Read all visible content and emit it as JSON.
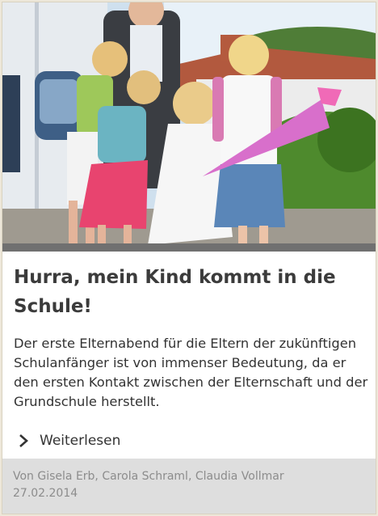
{
  "article": {
    "image_icon": "school-enrollment-photo",
    "title": "Hurra, mein Kind kommt in die Schule!",
    "lead": "Der erste Elternabend für die Eltern der zukünftigen Schulanfänger ist von immenser Bedeutung, da er den ersten Kontakt zwischen der Elternschaft und der Grundschule herstellt.",
    "read_more_icon": "chevron-right-icon",
    "read_more_label": "Weiterlesen",
    "authors": "Von Gisela Erb, Carola Schraml, Claudia Vollmar",
    "date": "27.02.2014"
  },
  "colors": {
    "page_background": "#ede7d9",
    "card_background": "#ffffff",
    "footer_background": "#dedede",
    "title_text": "#3b3b3b",
    "meta_text": "#8c8c8c"
  }
}
